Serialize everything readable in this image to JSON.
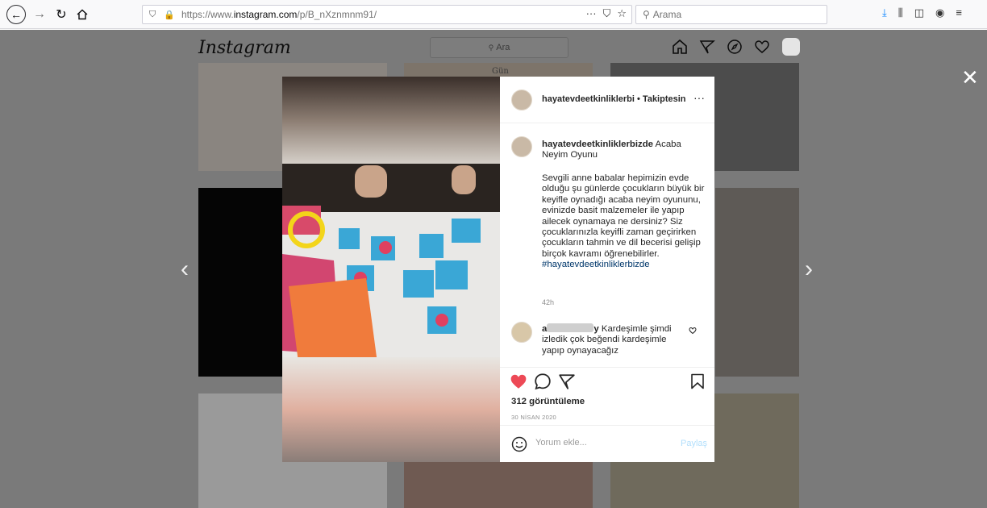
{
  "browser": {
    "url_prefix": "https://www.",
    "url_domain": "instagram.com",
    "url_path": "/p/B_nXznmnm91/",
    "search_placeholder": "Arama",
    "url_actions_more": "···"
  },
  "instagram": {
    "logo": "Instagram",
    "search_placeholder": "Ara",
    "tile_label": "Gün",
    "close": "✕",
    "prev": "‹",
    "next": "›"
  },
  "post": {
    "username": "hayatevdeetkinliklerbi",
    "separator": " • ",
    "follow_status": "Takiptesin",
    "more": "···",
    "caption_user": "hayatevdeetkinliklerbizde",
    "caption_title": " Acaba Neyim Oyunu",
    "caption_body": "Sevgili anne babalar hepimizin evde olduğu şu günlerde çocukların büyük bir keyifle oynadığı acaba neyim oyununu, evinizde basit malzemeler ile yapıp ailecek oynamaya ne dersiniz? Siz çocuklarınızla keyifli zaman geçirirken çocukların tahmin ve dil becerisi gelişip birçok kavramı öğrenebilirler.",
    "hashtag": "#hayatevdeetkinliklerbizde",
    "time": "42h",
    "comment_user_initial": "a",
    "comment_user_end": "y",
    "comment_text": " Kardeşimle şimdi izledik çok beğendi kardeşimle yapıp oynayacağız",
    "views": "312 görüntüleme",
    "date": "30 NİSAN 2020",
    "comment_placeholder": "Yorum ekle...",
    "post_label": "Paylaş"
  },
  "colors": {
    "like": "#ed4956",
    "link": "#00376b",
    "post_button": "#b2dffc",
    "overlay": "#7a7a7a"
  },
  "icons": [
    "back-icon",
    "forward-icon",
    "reload-icon",
    "home-icon",
    "shield-icon",
    "lock-icon",
    "bookmark-star-icon",
    "pocket-icon",
    "download-icon",
    "library-icon",
    "sidebar-icon",
    "account-icon",
    "menu-icon",
    "home-icon",
    "direct-icon",
    "explore-icon",
    "heart-icon",
    "close-icon",
    "chevron-left-icon",
    "chevron-right-icon",
    "heart-filled-icon",
    "comment-icon",
    "share-icon",
    "save-icon",
    "emoji-icon"
  ]
}
